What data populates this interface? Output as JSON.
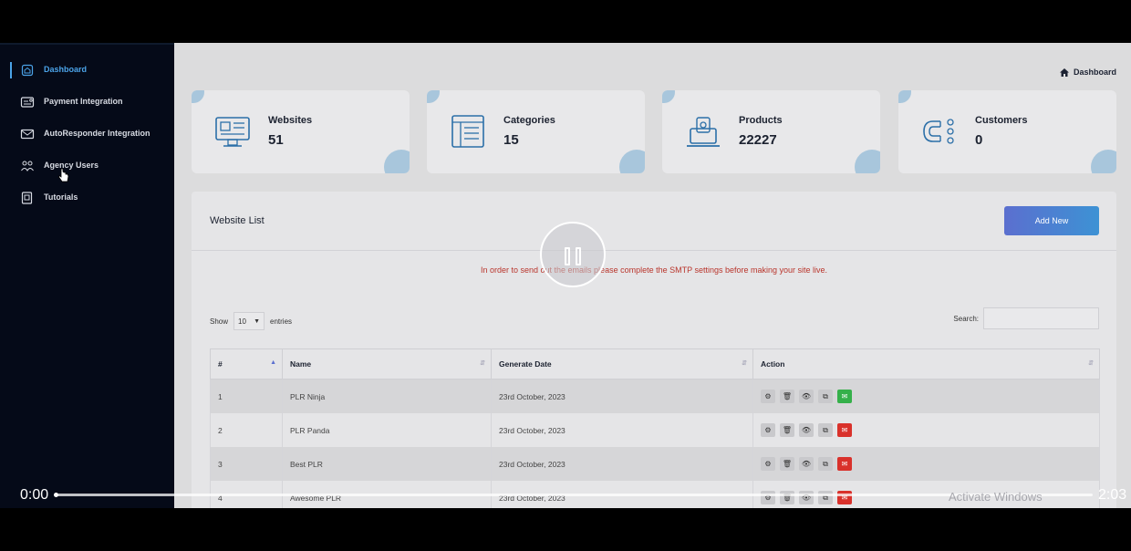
{
  "sidebar": {
    "items": [
      {
        "label": "Dashboard",
        "icon": "home-icon",
        "active": true
      },
      {
        "label": "Payment Integration",
        "icon": "payment-icon"
      },
      {
        "label": "AutoResponder Integration",
        "icon": "email-icon"
      },
      {
        "label": "Agency Users",
        "icon": "users-icon"
      },
      {
        "label": "Tutorials",
        "icon": "tutorial-icon"
      }
    ]
  },
  "breadcrumb": {
    "icon": "home-icon",
    "label": "Dashboard"
  },
  "stats": [
    {
      "title": "Websites",
      "value": "51",
      "icon": "website-icon"
    },
    {
      "title": "Categories",
      "value": "15",
      "icon": "categories-icon"
    },
    {
      "title": "Products",
      "value": "22227",
      "icon": "products-icon"
    },
    {
      "title": "Customers",
      "value": "0",
      "icon": "customers-magnet-icon"
    }
  ],
  "website_list": {
    "title": "Website List",
    "add_button": "Add New",
    "warning": "In order to send out the emails please complete the SMTP settings before making your site live.",
    "show_label": "Show",
    "entries_value": "10",
    "entries_label": "entries",
    "search_label": "Search:",
    "columns": [
      "#",
      "Name",
      "Generate Date",
      "Action"
    ],
    "rows": [
      {
        "num": "1",
        "name": "PLR Ninja",
        "date": "23rd October, 2023",
        "mail_status": "green"
      },
      {
        "num": "2",
        "name": "PLR Panda",
        "date": "23rd October, 2023",
        "mail_status": "red"
      },
      {
        "num": "3",
        "name": "Best PLR",
        "date": "23rd October, 2023",
        "mail_status": "red"
      },
      {
        "num": "4",
        "name": "Awesome PLR",
        "date": "23rd October, 2023",
        "mail_status": "red"
      }
    ]
  },
  "player": {
    "current_time": "0:00",
    "duration": "2:03",
    "progress": 0.0
  },
  "watermark": "Activate Windows",
  "colors": {
    "accent": "#4ba3e8",
    "warning": "#b9352c",
    "mail_green": "#35b04a",
    "mail_red": "#d9312b"
  }
}
